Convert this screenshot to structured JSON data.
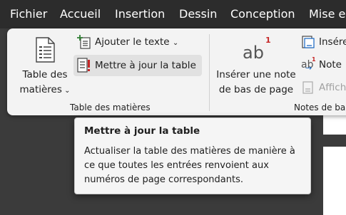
{
  "menubar": {
    "tabs": [
      "Fichier",
      "Accueil",
      "Insertion",
      "Dessin",
      "Conception",
      "Mise en"
    ]
  },
  "ribbon": {
    "toc_group": {
      "table_button": {
        "line1": "Table des",
        "line2": "matières",
        "icon": "table-of-contents-icon"
      },
      "add_text_label": "Ajouter le texte",
      "update_table_label": "Mettre à jour la table",
      "group_label": "Table des matières"
    },
    "footnotes_group": {
      "insert_footnote": {
        "line1": "Insérer une note",
        "line2": "de bas de page",
        "icon_text": "ab",
        "icon_super": "1"
      },
      "insert_endnote_label": "Insérer",
      "next_note_label": "Note",
      "show_notes_label": "Affich",
      "group_label": "Notes de ba"
    }
  },
  "tooltip": {
    "title": "Mettre à jour la table",
    "body": "Actualiser la table des matières de manière à ce que toutes les entrées renvoient aux numéros de page correspondants."
  }
}
